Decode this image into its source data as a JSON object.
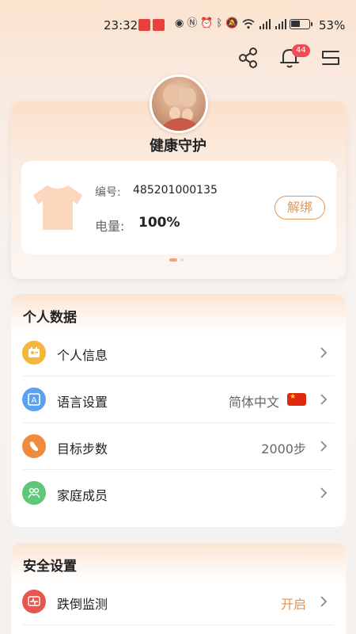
{
  "status_bar": {
    "time": "23:32",
    "battery_pct": "53%",
    "battery_level": 0.53,
    "icons": [
      "eye-icon",
      "nfc-icon",
      "alarm-icon",
      "bluetooth-icon",
      "mute-icon",
      "wifi-icon",
      "signal-icon",
      "signal-icon"
    ]
  },
  "header": {
    "notification_count": "44"
  },
  "device": {
    "title": "健康守护",
    "serial_label": "编号:",
    "serial_value": "485201000135",
    "power_label": "电量:",
    "power_value": "100%",
    "unbind_label": "解绑",
    "device_icon": "shirt-icon"
  },
  "personal": {
    "title": "个人数据",
    "rows": [
      {
        "label": "个人信息",
        "value": "",
        "icon": "id-card-icon",
        "color": "#f4b73b"
      },
      {
        "label": "语言设置",
        "value": "简体中文",
        "icon": "language-icon",
        "color": "#5aa1f0"
      },
      {
        "label": "目标步数",
        "value": "2000步",
        "icon": "footprint-icon",
        "color": "#f08a3c"
      },
      {
        "label": "家庭成员",
        "value": "",
        "icon": "family-icon",
        "color": "#5ec77a"
      }
    ]
  },
  "security": {
    "title": "安全设置",
    "rows": [
      {
        "label": "跌倒监测",
        "value": "开启",
        "icon": "heart-monitor-icon",
        "color": "#e8574f"
      }
    ]
  },
  "colors": {
    "accent": "#e8924a",
    "badge": "#f24a57"
  }
}
